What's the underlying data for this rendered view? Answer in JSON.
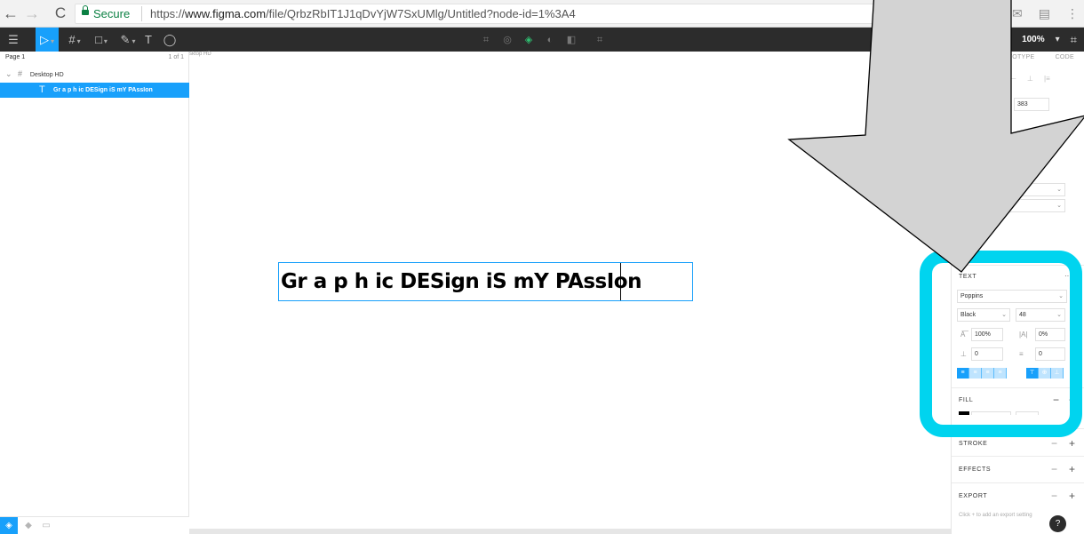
{
  "browser": {
    "back_icon": "←",
    "forward_icon": "→",
    "reload_icon": "C",
    "secure_label": "Secure",
    "url_prefix": "https://",
    "url_host": "www.figma.com",
    "url_path": "/file/QrbzRbIT1J1qDvYjW7SxUMlg/Untitled?node-id=1%3A4"
  },
  "toolbar": {
    "tools": [
      "move-tool",
      "frame-tool",
      "shape-tool",
      "pen-tool",
      "text-tool",
      "comment-tool"
    ],
    "zoom_label": "100%"
  },
  "layers": {
    "page_label": "Page 1",
    "page_count": "1 of 1",
    "frame_label": "Desktop HD",
    "text_layer_label": "Gr a p h ic DESign iS mY PAssIon"
  },
  "canvas": {
    "frame_tag": "sktop HD",
    "text": "Gr a p h ic DESign iS mY PAssIon"
  },
  "properties": {
    "tab_prototype": "OTOTYPE",
    "tab_code": "CODE",
    "height_value": "383",
    "text_section": "TEXT",
    "more_icon": "···",
    "font_family": "Poppins",
    "font_weight": "Black",
    "font_size": "48",
    "line_height": "100%",
    "letter_spacing": "0%",
    "paragraph_spacing": "0",
    "paragraph_indent": "0",
    "fill_section": "FILL",
    "stroke_section": "STROKE",
    "effects_section": "EFFECTS",
    "export_section": "EXPORT",
    "export_hint": "Click + to add an export setting",
    "help_label": "?"
  },
  "colors": {
    "accent": "#18a0fb",
    "highlight": "#00d4ef",
    "toolbar_bg": "#2c2c2c"
  }
}
